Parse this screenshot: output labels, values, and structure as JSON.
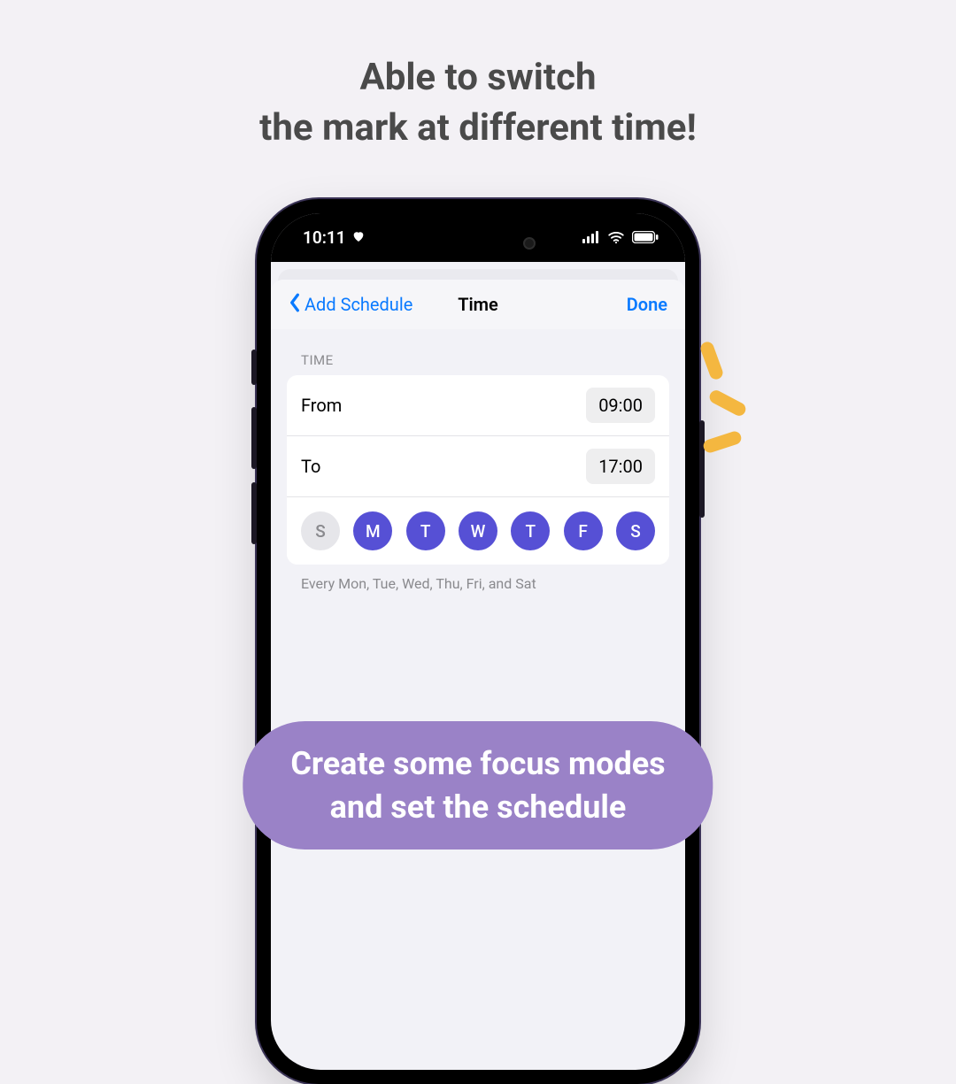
{
  "headline": "Able to switch\nthe mark at different time!",
  "caption": "Create some focus modes\nand set the schedule",
  "statusbar": {
    "time": "10:11"
  },
  "nav": {
    "back_label": "Add Schedule",
    "title": "Time",
    "done_label": "Done"
  },
  "section_header": "TIME",
  "rows": {
    "from_label": "From",
    "from_value": "09:00",
    "to_label": "To",
    "to_value": "17:00"
  },
  "days": [
    {
      "letter": "S",
      "selected": false
    },
    {
      "letter": "M",
      "selected": true
    },
    {
      "letter": "T",
      "selected": true
    },
    {
      "letter": "W",
      "selected": true
    },
    {
      "letter": "T",
      "selected": true
    },
    {
      "letter": "F",
      "selected": true
    },
    {
      "letter": "S",
      "selected": true
    }
  ],
  "footer_note": "Every Mon, Tue, Wed, Thu, Fri, and Sat"
}
